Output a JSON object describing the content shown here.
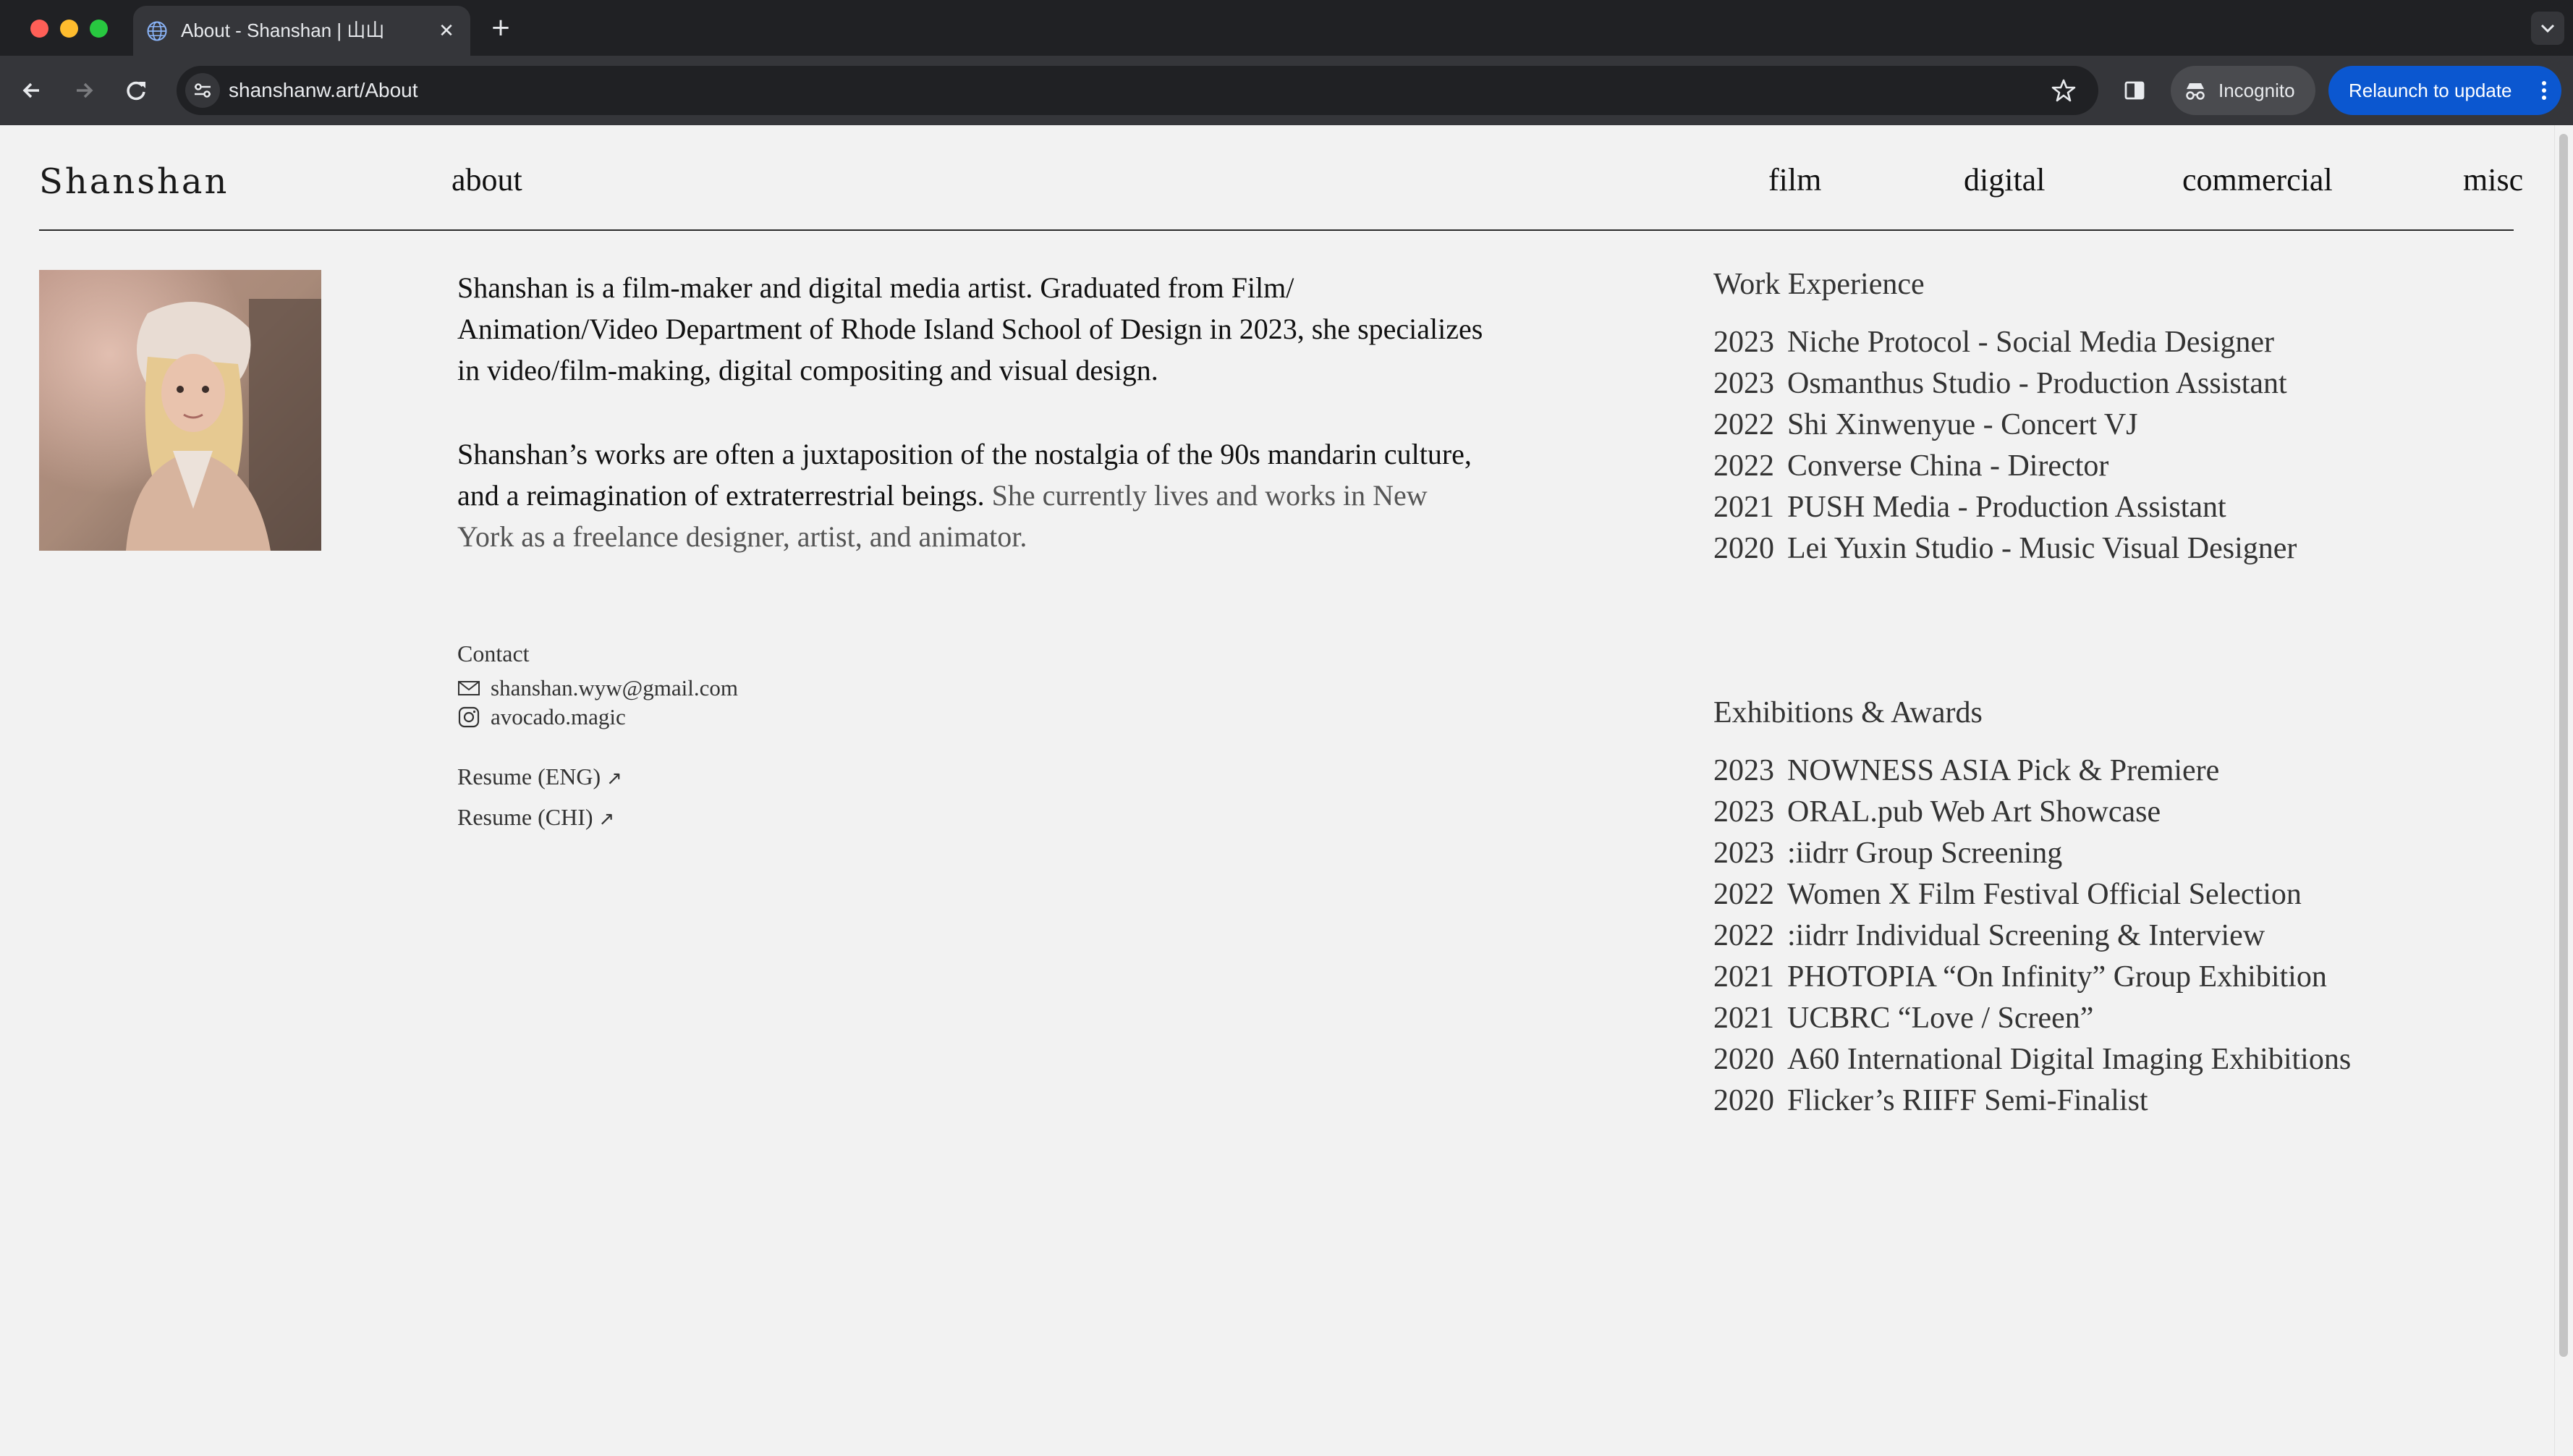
{
  "browser": {
    "tab_title": "About - Shanshan | 山山",
    "url": "shanshanw.art/About",
    "incognito_label": "Incognito",
    "relaunch_label": "Relaunch to update"
  },
  "site": {
    "logo": "Shanshan",
    "nav": {
      "about": "about",
      "film": "film",
      "digital": "digital",
      "commercial": "commercial",
      "misc": "misc"
    }
  },
  "bio": {
    "paragraph1": "Shanshan is a film-maker and digital media artist. Graduated from Film/ Animation/Video Department of Rhode Island School of Design in 2023, she specializes in video/film-making, digital compositing and visual design.",
    "paragraph2_main": "Shanshan’s works are often a juxtaposition of the nostalgia of the 90s mandarin culture, and a reimagination of extraterrestrial beings.",
    "paragraph2_muted": "She currently lives and works in New York as a freelance designer, artist, and animator."
  },
  "contact": {
    "title": "Contact",
    "email": "shanshan.wyw@gmail.com",
    "instagram": "avocado.magic",
    "resume_eng": "Resume (ENG)",
    "resume_chi": "Resume (CHI)"
  },
  "work_experience": {
    "title": "Work Experience",
    "items": [
      {
        "year": "2023",
        "text": "Niche Protocol - Social Media Designer"
      },
      {
        "year": "2023",
        "text": "Osmanthus Studio - Production Assistant"
      },
      {
        "year": "2022",
        "text": "Shi Xinwenyue - Concert VJ"
      },
      {
        "year": "2022",
        "text": "Converse China - Director"
      },
      {
        "year": "2021",
        "text": "PUSH Media - Production Assistant"
      },
      {
        "year": "2020",
        "text": "Lei Yuxin Studio - Music Visual Designer"
      }
    ]
  },
  "exhibitions": {
    "title": "Exhibitions & Awards",
    "items": [
      {
        "year": "2023",
        "text": "NOWNESS ASIA Pick & Premiere"
      },
      {
        "year": "2023",
        "text": "ORAL.pub Web Art Showcase"
      },
      {
        "year": "2023",
        "text": ":iidrr Group Screening"
      },
      {
        "year": "2022",
        "text": "Women X Film Festival Official Selection"
      },
      {
        "year": "2022",
        "text": ":iidrr Individual Screening & Interview"
      },
      {
        "year": "2021",
        "text": "PHOTOPIA “On Infinity” Group Exhibition"
      },
      {
        "year": "2021",
        "text": "UCBRC “Love / Screen”"
      },
      {
        "year": "2020",
        "text": "A60 International Digital Imaging Exhibitions"
      },
      {
        "year": "2020",
        "text": "Flicker’s RIIFF Semi-Finalist"
      }
    ]
  }
}
